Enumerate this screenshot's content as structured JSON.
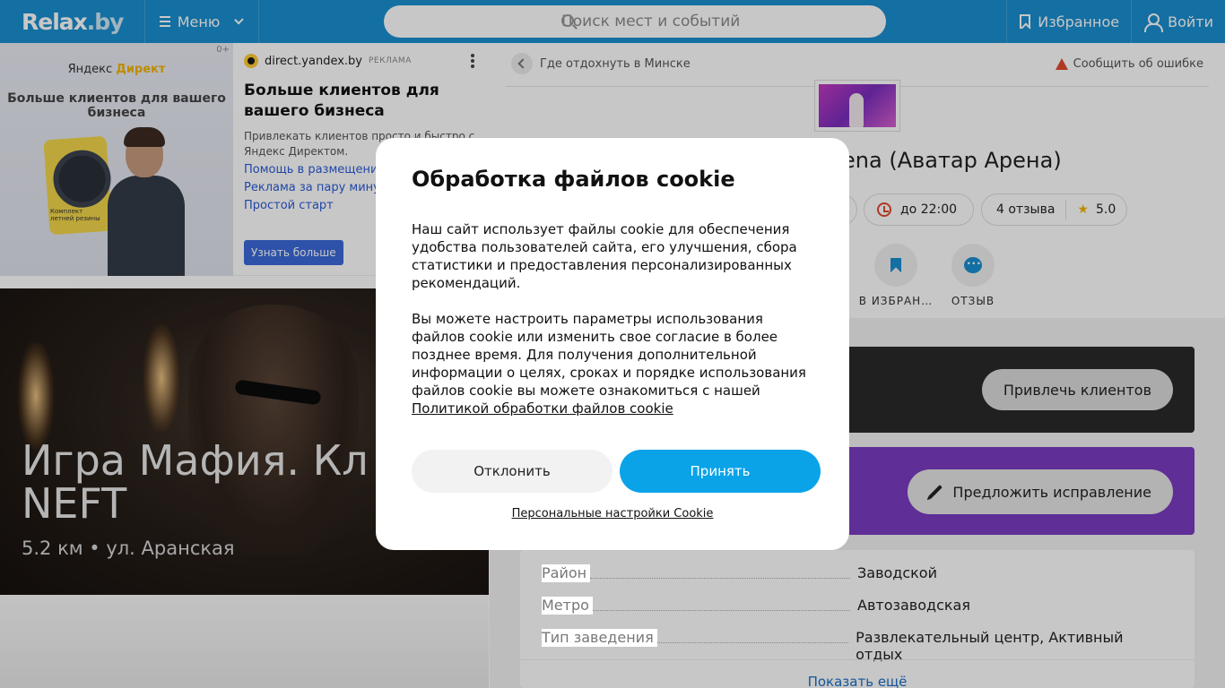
{
  "header": {
    "logo": "Relax",
    "logo_suffix": ".by",
    "menu_label": "Меню",
    "search_placeholder": "Поиск мест и событий",
    "favorites_label": "Избранное",
    "login_label": "Войти"
  },
  "ad": {
    "counter": "0+",
    "image_brand_a": "Яндекс",
    "image_brand_b": "Директ",
    "image_slogan": "Больше клиентов для вашего бизнеса",
    "image_card_text": "Комплект летней резины",
    "source": "direct.yandex.by",
    "source_tag": "РЕКЛАМА",
    "title": "Больше клиентов для вашего бизнеса",
    "description": "Привлекать клиентов просто и быстро с Яндекс Директом.",
    "links": [
      "Помощь в размещении",
      "Реклама за пару минут",
      "Простой старт"
    ],
    "cta": "Узнать больше"
  },
  "hero": {
    "title_line1": "Игра Мафия. Кл",
    "title_line2": "NEFT",
    "meta": "5.2 км • ул. Аранская"
  },
  "place": {
    "breadcrumb": "Где отдохнуть в Минске",
    "report": "Сообщить об ошибке",
    "title_visible": "ena (Аватар Арена)",
    "hours": "до 22:00",
    "reviews": "4 отзыва",
    "rating": "5.0",
    "actions": [
      {
        "label": "В ИЗБРАН…",
        "icon": "bookmark-icon"
      },
      {
        "label": "ОТЗЫВ",
        "icon": "chat-icon"
      }
    ],
    "attract_btn": "Привлечь клиентов",
    "suggest_btn": "Предложить исправление",
    "info": [
      {
        "key": "Район",
        "value": "Заводской"
      },
      {
        "key": "Метро",
        "value": "Автозаводская"
      },
      {
        "key": "Тип заведения",
        "value": "Развлекательный центр, Активный отдых"
      }
    ],
    "show_more": "Показать ещё"
  },
  "cookie": {
    "title": "Обработка файлов cookie",
    "p1": "Наш сайт использует файлы cookie для обеспечения удобства пользователей сайта, его улучшения, сбора статистики и предоставления персонализированных рекомендаций.",
    "p2": "Вы можете настроить параметры использования файлов cookie или изменить свое согласие в более позднее время. Для получения дополнительной информации о целях, сроках и порядке использования файлов cookie вы можете ознакомиться с нашей",
    "policy_link": "Политикой обработки файлов cookie",
    "decline": "Отклонить",
    "accept": "Принять",
    "personal": "Персональные настройки Cookie"
  },
  "colors": {
    "header": "#1a8fd0",
    "accept": "#0aa3e8",
    "purple_block": "#7a3cc0",
    "dark_block": "#2a2a2a"
  }
}
